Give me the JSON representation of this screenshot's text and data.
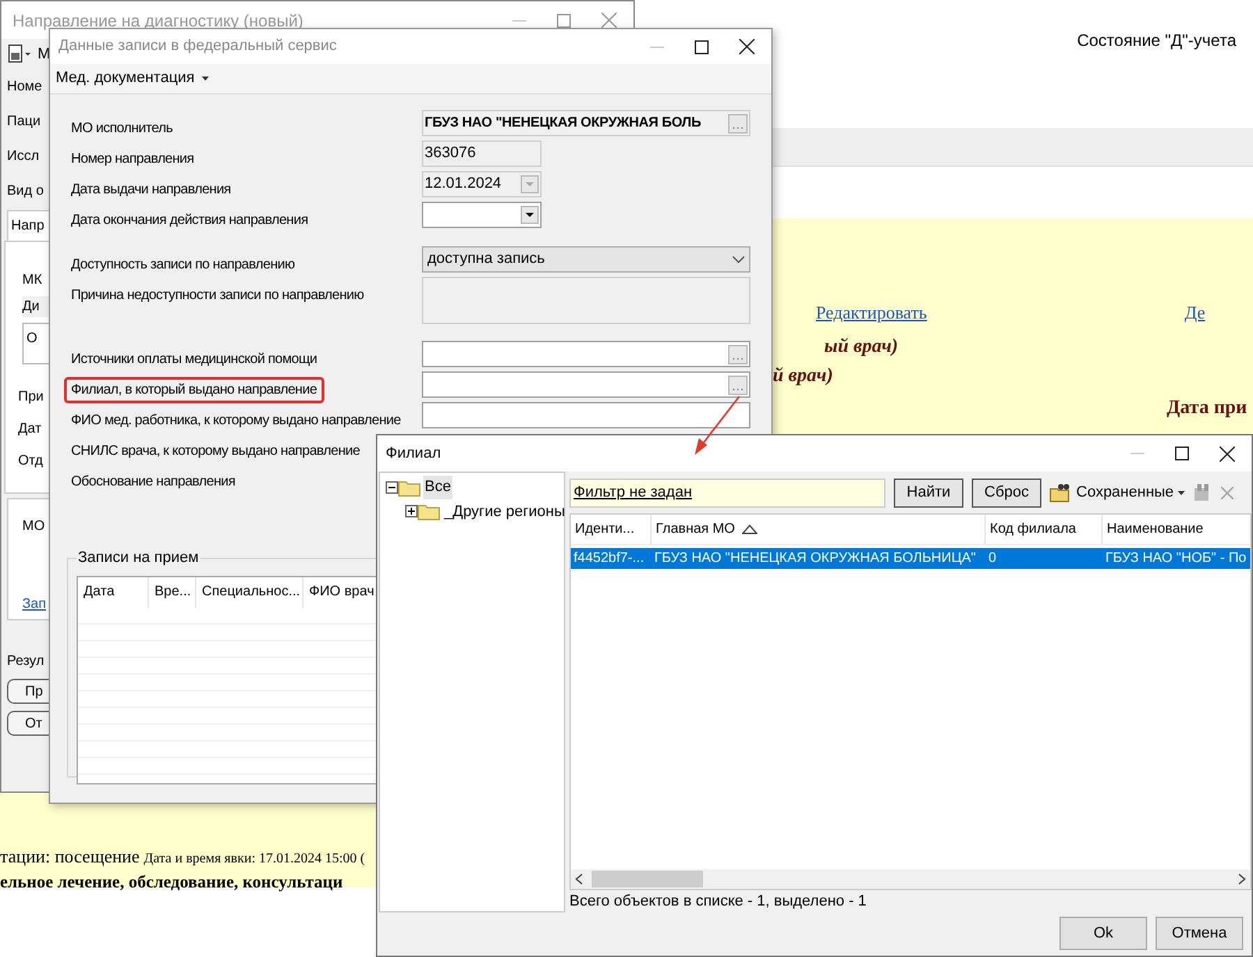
{
  "background_page": {
    "status_heading": "Состояние \"Д\"-учета",
    "edit_link": "Редактировать",
    "link_2": "Де",
    "line_1": "ый врач)",
    "line_2": "й врач)",
    "date_heading": "Дата при",
    "visit_text": "тации: посещение",
    "visit_date": "Дата и время явки: 17.01.2024 15:00 (",
    "treatment_line": "ельное лечение, обследование, консультаци"
  },
  "window_referral": {
    "title": "Направление на диагностику (новый)",
    "toolbar_label": "М",
    "labels": [
      "Номе",
      "Паци",
      "Иссл",
      "Вид о"
    ],
    "tab": "Напр",
    "group_header": "МК",
    "column_header": "Ди",
    "field_text": "О",
    "labels_2": [
      "При",
      "Дат",
      "Отд"
    ],
    "mo_label": "МО",
    "link": "Зап",
    "result_label": "Резул",
    "buttons": [
      "Пр",
      "От"
    ]
  },
  "window_records": {
    "title": "Данные записи в федеральный сервис",
    "menu": "Мед. документация",
    "fields": [
      {
        "label": "МО исполнитель",
        "kind": "lookup",
        "value": "ГБУЗ НАО \"НЕНЕЦКАЯ ОКРУЖНАЯ БОЛЬ",
        "disabled": true,
        "highlighted": false
      },
      {
        "label": "Номер направления",
        "kind": "text",
        "value": "363076",
        "disabled": true,
        "highlighted": false
      },
      {
        "label": "Дата выдачи направления",
        "kind": "date",
        "value": "12.01.2024",
        "disabled": true,
        "highlighted": false
      },
      {
        "label": "Дата окончания действия направления",
        "kind": "date",
        "disabled": false,
        "highlighted": false
      },
      {
        "label": "Доступность записи по направлению",
        "kind": "select",
        "value": "доступна запись",
        "disabled": false,
        "highlighted": false
      },
      {
        "label": "Причина недоступности записи по направлению",
        "kind": "area",
        "disabled": true,
        "highlighted": false
      },
      {
        "label": "Источники оплаты медицинской помощи",
        "kind": "lookup",
        "disabled": false,
        "highlighted": false
      },
      {
        "label": "Филиал, в который выдано направление",
        "kind": "lookup",
        "disabled": false,
        "highlighted": true
      },
      {
        "label": "ФИО мед. работника, к которому выдано направление",
        "kind": "text",
        "disabled": false,
        "highlighted": false
      },
      {
        "label": "СНИЛС врача, к которому выдано направление",
        "kind": "none",
        "highlighted": false
      },
      {
        "label": "Обоснование направления",
        "kind": "none",
        "highlighted": false
      }
    ],
    "appointments": {
      "title": "Записи на прием",
      "columns": [
        "Дата",
        "Вре...",
        "Специальнос...",
        "ФИО врач"
      ]
    }
  },
  "window_branch": {
    "title": "Филиал",
    "tree": [
      {
        "label": "Все",
        "expanded": true,
        "selected": true,
        "children": [
          {
            "label": "_Другие регионы",
            "expanded": false,
            "selected": false
          }
        ]
      }
    ],
    "filter": "Фильтр не задан",
    "buttons": [
      "Найти",
      "Сброс"
    ],
    "saved_button": "Сохраненные",
    "columns": [
      {
        "label": "Иденти...",
        "sorted": false
      },
      {
        "label": "Главная МО",
        "sorted": true
      },
      {
        "label": "Код филиала",
        "sorted": false
      },
      {
        "label": "Наименование",
        "sorted": false
      }
    ],
    "rows": [
      {
        "cells": [
          "f4452bf7-...",
          "ГБУЗ НАО \"НЕНЕЦКАЯ ОКРУЖНАЯ БОЛЬНИЦА\"",
          "0",
          "ГБУЗ НАО \"НОБ\" - По"
        ],
        "selected": true
      }
    ],
    "status": "Всего объектов в списке - 1, выделено - 1",
    "footer_buttons": [
      "Ok",
      "Отмена"
    ]
  }
}
